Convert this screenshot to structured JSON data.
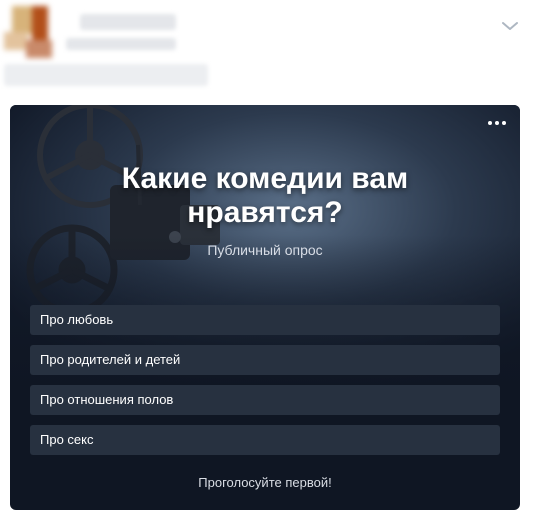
{
  "header": {
    "avatar": "avatar-blurred",
    "menu_icon": "chevron-down-icon"
  },
  "poll": {
    "title": "Какие комедии вам нравятся?",
    "subtitle": "Публичный опрос",
    "menu_icon": "more-dots-icon",
    "background_icon": "film-projector-image",
    "options": [
      {
        "label": "Про любовь"
      },
      {
        "label": "Про родителей и детей"
      },
      {
        "label": "Про отношения полов"
      },
      {
        "label": "Про секс"
      }
    ],
    "vote_prompt": "Проголосуйте первой!"
  },
  "colors": {
    "card_background": "#0f1623",
    "option_background": "#273140",
    "text": "#ffffff",
    "chevron": "#aeb7c2"
  }
}
